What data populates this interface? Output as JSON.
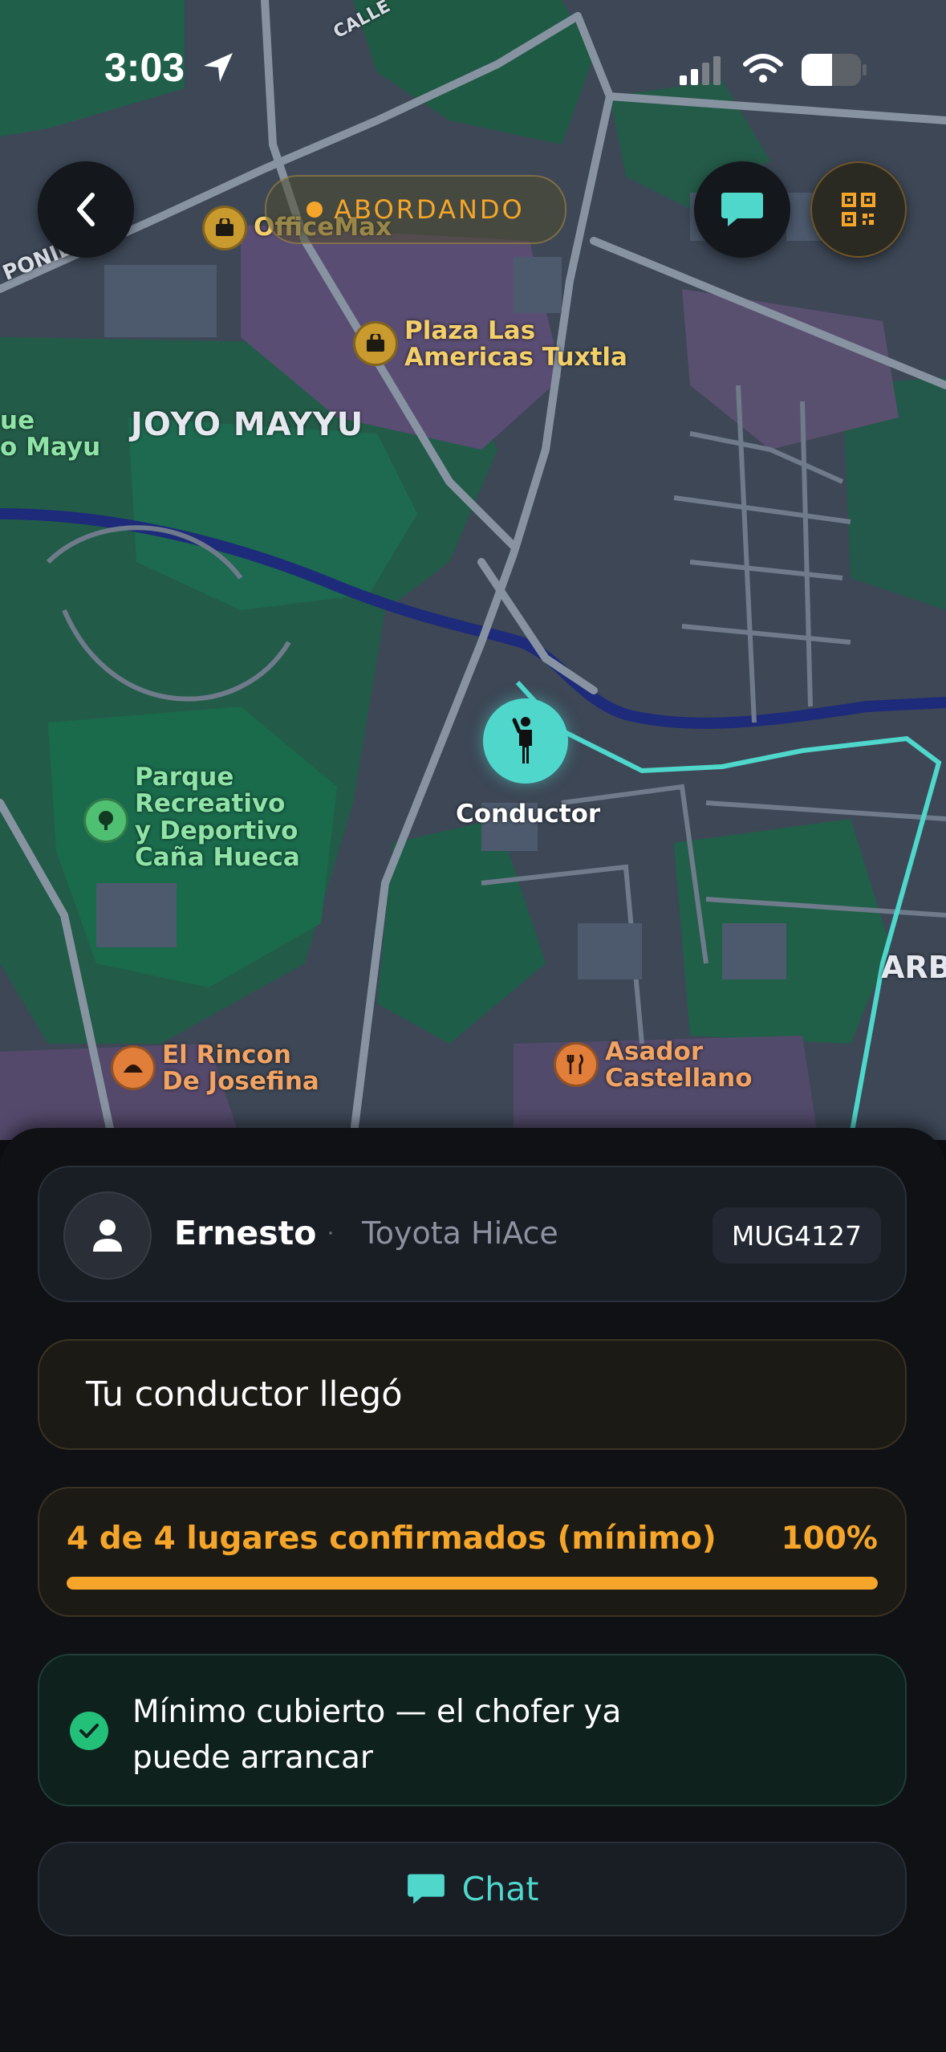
{
  "status_bar": {
    "time": "3:03"
  },
  "header": {
    "status_pill": "ABORDANDO"
  },
  "map": {
    "neighborhood": "JOYO MAYYU",
    "partial_left_label": [
      "ue",
      "o Mayu"
    ],
    "partial_right_label": "ARB",
    "road_label_poniente": "PONIEN",
    "road_label_calle": "CALLE",
    "pois": [
      {
        "name": "OfficeMax",
        "icon": "shopping-bag-icon"
      },
      {
        "name": "Plaza Las\nAmericas Tuxtla",
        "icon": "shopping-bag-icon"
      },
      {
        "name": "Parque\nRecreativo\ny Deportivo\nCaña Hueca",
        "icon": "tree-icon"
      },
      {
        "name": "El Rincon\nDe Josefina",
        "icon": "bakery-icon"
      },
      {
        "name": "Asador\nCastellano",
        "icon": "restaurant-icon"
      }
    ],
    "driver_label": "Conductor"
  },
  "driver": {
    "name": "Ernesto",
    "separator": "·",
    "vehicle": "Toyota HiAce",
    "plate": "MUG4127"
  },
  "arrival": {
    "message": "Tu conductor llegó"
  },
  "seats": {
    "label": "4 de 4 lugares confirmados (mínimo)",
    "percent_label": "100%",
    "progress": 1.0
  },
  "minimum": {
    "message": "Mínimo cubierto — el chofer ya puede arrancar"
  },
  "chat": {
    "label": "Chat"
  },
  "colors": {
    "accent": "#4fd7cc",
    "warning": "#f4a52a",
    "success": "#23c07a",
    "background": "#0f1115"
  }
}
